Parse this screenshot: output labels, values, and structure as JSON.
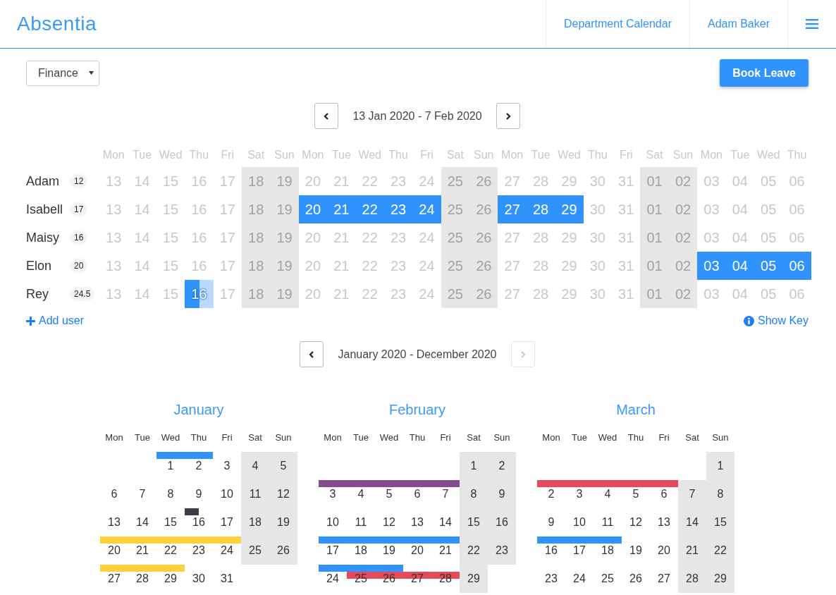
{
  "header": {
    "logo": "Absentia",
    "nav": [
      "Department Calendar",
      "Adam Baker"
    ]
  },
  "toolbar": {
    "department": "Finance",
    "book_button": "Book Leave"
  },
  "week_nav": {
    "range": "13 Jan 2020 - 7 Feb 2020",
    "prev_disabled": false,
    "next_disabled": false
  },
  "team": {
    "columns": [
      {
        "weekday": "Mon",
        "weekend": false
      },
      {
        "weekday": "Tue",
        "weekend": false
      },
      {
        "weekday": "Wed",
        "weekend": false
      },
      {
        "weekday": "Thu",
        "weekend": false
      },
      {
        "weekday": "Fri",
        "weekend": false
      },
      {
        "weekday": "Sat",
        "weekend": true
      },
      {
        "weekday": "Sun",
        "weekend": true
      },
      {
        "weekday": "Mon",
        "weekend": false
      },
      {
        "weekday": "Tue",
        "weekend": false
      },
      {
        "weekday": "Wed",
        "weekend": false
      },
      {
        "weekday": "Thu",
        "weekend": false
      },
      {
        "weekday": "Fri",
        "weekend": false
      },
      {
        "weekday": "Sat",
        "weekend": true
      },
      {
        "weekday": "Sun",
        "weekend": true
      },
      {
        "weekday": "Mon",
        "weekend": false
      },
      {
        "weekday": "Tue",
        "weekend": false
      },
      {
        "weekday": "Wed",
        "weekend": false
      },
      {
        "weekday": "Thu",
        "weekend": false
      },
      {
        "weekday": "Fri",
        "weekend": false
      },
      {
        "weekday": "Sat",
        "weekend": true
      },
      {
        "weekday": "Sun",
        "weekend": true
      },
      {
        "weekday": "Mon",
        "weekend": false
      },
      {
        "weekday": "Tue",
        "weekend": false
      },
      {
        "weekday": "Wed",
        "weekend": false
      },
      {
        "weekday": "Thu",
        "weekend": false
      }
    ],
    "members": [
      {
        "name": "Adam",
        "balance": "12",
        "days": [
          {
            "date": "13",
            "kind": "free"
          },
          {
            "date": "14",
            "kind": "free"
          },
          {
            "date": "15",
            "kind": "free"
          },
          {
            "date": "16",
            "kind": "free"
          },
          {
            "date": "17",
            "kind": "free"
          },
          {
            "date": "18",
            "kind": "free"
          },
          {
            "date": "19",
            "kind": "free"
          },
          {
            "date": "20",
            "kind": "free"
          },
          {
            "date": "21",
            "kind": "free"
          },
          {
            "date": "22",
            "kind": "free"
          },
          {
            "date": "23",
            "kind": "free"
          },
          {
            "date": "24",
            "kind": "free"
          },
          {
            "date": "25",
            "kind": "free"
          },
          {
            "date": "26",
            "kind": "free"
          },
          {
            "date": "27",
            "kind": "free"
          },
          {
            "date": "28",
            "kind": "free"
          },
          {
            "date": "29",
            "kind": "free"
          },
          {
            "date": "30",
            "kind": "free"
          },
          {
            "date": "31",
            "kind": "free"
          },
          {
            "date": "01",
            "kind": "free"
          },
          {
            "date": "02",
            "kind": "free"
          },
          {
            "date": "03",
            "kind": "free"
          },
          {
            "date": "04",
            "kind": "free"
          },
          {
            "date": "05",
            "kind": "free"
          },
          {
            "date": "06",
            "kind": "free"
          }
        ]
      },
      {
        "name": "Isabell",
        "balance": "17",
        "days": [
          {
            "date": "13",
            "kind": "free"
          },
          {
            "date": "14",
            "kind": "free"
          },
          {
            "date": "15",
            "kind": "free"
          },
          {
            "date": "16",
            "kind": "free"
          },
          {
            "date": "17",
            "kind": "free"
          },
          {
            "date": "18",
            "kind": "free"
          },
          {
            "date": "19",
            "kind": "free"
          },
          {
            "date": "20",
            "kind": "leave"
          },
          {
            "date": "21",
            "kind": "leave"
          },
          {
            "date": "22",
            "kind": "leave"
          },
          {
            "date": "23",
            "kind": "leave"
          },
          {
            "date": "24",
            "kind": "leave"
          },
          {
            "date": "25",
            "kind": "free"
          },
          {
            "date": "26",
            "kind": "free"
          },
          {
            "date": "27",
            "kind": "leave"
          },
          {
            "date": "28",
            "kind": "leave"
          },
          {
            "date": "29",
            "kind": "leave"
          },
          {
            "date": "30",
            "kind": "free"
          },
          {
            "date": "31",
            "kind": "free"
          },
          {
            "date": "01",
            "kind": "free"
          },
          {
            "date": "02",
            "kind": "free"
          },
          {
            "date": "03",
            "kind": "free"
          },
          {
            "date": "04",
            "kind": "free"
          },
          {
            "date": "05",
            "kind": "free"
          },
          {
            "date": "06",
            "kind": "free"
          }
        ]
      },
      {
        "name": "Maisy",
        "balance": "16",
        "days": [
          {
            "date": "13",
            "kind": "free"
          },
          {
            "date": "14",
            "kind": "free"
          },
          {
            "date": "15",
            "kind": "free"
          },
          {
            "date": "16",
            "kind": "free"
          },
          {
            "date": "17",
            "kind": "free"
          },
          {
            "date": "18",
            "kind": "free"
          },
          {
            "date": "19",
            "kind": "free"
          },
          {
            "date": "20",
            "kind": "free"
          },
          {
            "date": "21",
            "kind": "free"
          },
          {
            "date": "22",
            "kind": "free"
          },
          {
            "date": "23",
            "kind": "free"
          },
          {
            "date": "24",
            "kind": "free"
          },
          {
            "date": "25",
            "kind": "free"
          },
          {
            "date": "26",
            "kind": "free"
          },
          {
            "date": "27",
            "kind": "free"
          },
          {
            "date": "28",
            "kind": "free"
          },
          {
            "date": "29",
            "kind": "free"
          },
          {
            "date": "30",
            "kind": "free"
          },
          {
            "date": "31",
            "kind": "free"
          },
          {
            "date": "01",
            "kind": "free"
          },
          {
            "date": "02",
            "kind": "free"
          },
          {
            "date": "03",
            "kind": "free"
          },
          {
            "date": "04",
            "kind": "free"
          },
          {
            "date": "05",
            "kind": "free"
          },
          {
            "date": "06",
            "kind": "free"
          }
        ]
      },
      {
        "name": "Elon",
        "balance": "20",
        "days": [
          {
            "date": "13",
            "kind": "free"
          },
          {
            "date": "14",
            "kind": "free"
          },
          {
            "date": "15",
            "kind": "free"
          },
          {
            "date": "16",
            "kind": "free"
          },
          {
            "date": "17",
            "kind": "free"
          },
          {
            "date": "18",
            "kind": "free"
          },
          {
            "date": "19",
            "kind": "free"
          },
          {
            "date": "20",
            "kind": "free"
          },
          {
            "date": "21",
            "kind": "free"
          },
          {
            "date": "22",
            "kind": "free"
          },
          {
            "date": "23",
            "kind": "free"
          },
          {
            "date": "24",
            "kind": "free"
          },
          {
            "date": "25",
            "kind": "free"
          },
          {
            "date": "26",
            "kind": "free"
          },
          {
            "date": "27",
            "kind": "free"
          },
          {
            "date": "28",
            "kind": "free"
          },
          {
            "date": "29",
            "kind": "free"
          },
          {
            "date": "30",
            "kind": "free"
          },
          {
            "date": "31",
            "kind": "free"
          },
          {
            "date": "01",
            "kind": "free"
          },
          {
            "date": "02",
            "kind": "free"
          },
          {
            "date": "03",
            "kind": "leave"
          },
          {
            "date": "04",
            "kind": "leave"
          },
          {
            "date": "05",
            "kind": "leave"
          },
          {
            "date": "06",
            "kind": "leave"
          }
        ]
      },
      {
        "name": "Rey",
        "balance": "24.5",
        "days": [
          {
            "date": "13",
            "kind": "free"
          },
          {
            "date": "14",
            "kind": "free"
          },
          {
            "date": "15",
            "kind": "free"
          },
          {
            "date": "16",
            "kind": "half_leave"
          },
          {
            "date": "17",
            "kind": "free"
          },
          {
            "date": "18",
            "kind": "free"
          },
          {
            "date": "19",
            "kind": "free"
          },
          {
            "date": "20",
            "kind": "free"
          },
          {
            "date": "21",
            "kind": "free"
          },
          {
            "date": "22",
            "kind": "free"
          },
          {
            "date": "23",
            "kind": "free"
          },
          {
            "date": "24",
            "kind": "free"
          },
          {
            "date": "25",
            "kind": "free"
          },
          {
            "date": "26",
            "kind": "free"
          },
          {
            "date": "27",
            "kind": "free"
          },
          {
            "date": "28",
            "kind": "free"
          },
          {
            "date": "29",
            "kind": "free"
          },
          {
            "date": "30",
            "kind": "free"
          },
          {
            "date": "31",
            "kind": "free"
          },
          {
            "date": "01",
            "kind": "free"
          },
          {
            "date": "02",
            "kind": "free"
          },
          {
            "date": "03",
            "kind": "free"
          },
          {
            "date": "04",
            "kind": "free"
          },
          {
            "date": "05",
            "kind": "free"
          },
          {
            "date": "06",
            "kind": "free"
          }
        ]
      }
    ]
  },
  "add_user": "Add user",
  "show_key": "Show Key",
  "year_nav": {
    "range": "January 2020 - December 2020",
    "prev_disabled": false,
    "next_disabled": true
  },
  "months": [
    {
      "name": "January",
      "weekdays": [
        "Mon",
        "Tue",
        "Wed",
        "Thu",
        "Fri",
        "Sat",
        "Sun"
      ],
      "weeks": [
        [
          {
            "kind": "blank"
          },
          {
            "kind": "blank"
          },
          {
            "kind": "day",
            "text": "1",
            "weekend": false,
            "bars": [
              {
                "color": "#3093fd",
                "kind": "full_day",
                "lower": false
              }
            ]
          },
          {
            "kind": "day",
            "text": "2",
            "weekend": false,
            "bars": [
              {
                "color": "#3093fd",
                "kind": "full_day",
                "lower": false
              }
            ]
          },
          {
            "kind": "day",
            "text": "3",
            "weekend": false
          },
          {
            "kind": "day",
            "text": "4",
            "weekend": true
          },
          {
            "kind": "day",
            "text": "5",
            "weekend": true
          }
        ],
        [
          {
            "kind": "day",
            "text": "6",
            "weekend": false
          },
          {
            "kind": "day",
            "text": "7",
            "weekend": false
          },
          {
            "kind": "day",
            "text": "8",
            "weekend": false
          },
          {
            "kind": "day",
            "text": "9",
            "weekend": false
          },
          {
            "kind": "day",
            "text": "10",
            "weekend": false
          },
          {
            "kind": "day",
            "text": "11",
            "weekend": true
          },
          {
            "kind": "day",
            "text": "12",
            "weekend": true
          }
        ],
        [
          {
            "kind": "day",
            "text": "13",
            "weekend": false
          },
          {
            "kind": "day",
            "text": "14",
            "weekend": false
          },
          {
            "kind": "day",
            "text": "15",
            "weekend": false
          },
          {
            "kind": "day",
            "text": "16",
            "weekend": false,
            "bars": [
              {
                "color": "#3d3d4a",
                "kind": "half_day",
                "lower": false
              }
            ]
          },
          {
            "kind": "day",
            "text": "17",
            "weekend": false
          },
          {
            "kind": "day",
            "text": "18",
            "weekend": true
          },
          {
            "kind": "day",
            "text": "19",
            "weekend": true
          }
        ],
        [
          {
            "kind": "day",
            "text": "20",
            "weekend": false,
            "bars": [
              {
                "color": "#ffd03a",
                "kind": "full_day",
                "lower": false
              }
            ]
          },
          {
            "kind": "day",
            "text": "21",
            "weekend": false,
            "bars": [
              {
                "color": "#ffd03a",
                "kind": "full_day",
                "lower": false
              }
            ]
          },
          {
            "kind": "day",
            "text": "22",
            "weekend": false,
            "bars": [
              {
                "color": "#ffd03a",
                "kind": "full_day",
                "lower": false
              }
            ]
          },
          {
            "kind": "day",
            "text": "23",
            "weekend": false,
            "bars": [
              {
                "color": "#ffd03a",
                "kind": "full_day",
                "lower": false
              }
            ]
          },
          {
            "kind": "day",
            "text": "24",
            "weekend": false,
            "bars": [
              {
                "color": "#ffd03a",
                "kind": "full_day",
                "lower": false
              }
            ]
          },
          {
            "kind": "day",
            "text": "25",
            "weekend": true
          },
          {
            "kind": "day",
            "text": "26",
            "weekend": true
          }
        ],
        [
          {
            "kind": "day",
            "text": "27",
            "weekend": false,
            "bars": [
              {
                "color": "#ffd03a",
                "kind": "full_day",
                "lower": false
              }
            ]
          },
          {
            "kind": "day",
            "text": "28",
            "weekend": false,
            "bars": [
              {
                "color": "#ffd03a",
                "kind": "full_day",
                "lower": false
              }
            ]
          },
          {
            "kind": "day",
            "text": "29",
            "weekend": false,
            "bars": [
              {
                "color": "#ffd03a",
                "kind": "full_day",
                "lower": false
              }
            ]
          },
          {
            "kind": "day",
            "text": "30",
            "weekend": false
          },
          {
            "kind": "day",
            "text": "31",
            "weekend": false
          }
        ]
      ]
    },
    {
      "name": "February",
      "weekdays": [
        "Mon",
        "Tue",
        "Wed",
        "Thu",
        "Fri",
        "Sat",
        "Sun"
      ],
      "weeks": [
        [
          {
            "kind": "blank"
          },
          {
            "kind": "blank"
          },
          {
            "kind": "blank"
          },
          {
            "kind": "blank"
          },
          {
            "kind": "blank"
          },
          {
            "kind": "day",
            "text": "1",
            "weekend": true
          },
          {
            "kind": "day",
            "text": "2",
            "weekend": true
          }
        ],
        [
          {
            "kind": "day",
            "text": "3",
            "weekend": false,
            "bars": [
              {
                "color": "#884a8c",
                "kind": "full_day",
                "lower": false
              }
            ]
          },
          {
            "kind": "day",
            "text": "4",
            "weekend": false,
            "bars": [
              {
                "color": "#884a8c",
                "kind": "full_day",
                "lower": false
              }
            ]
          },
          {
            "kind": "day",
            "text": "5",
            "weekend": false,
            "bars": [
              {
                "color": "#884a8c",
                "kind": "full_day",
                "lower": false
              }
            ]
          },
          {
            "kind": "day",
            "text": "6",
            "weekend": false,
            "bars": [
              {
                "color": "#884a8c",
                "kind": "full_day",
                "lower": false
              }
            ]
          },
          {
            "kind": "day",
            "text": "7",
            "weekend": false,
            "bars": [
              {
                "color": "#884a8c",
                "kind": "full_day",
                "lower": false
              }
            ]
          },
          {
            "kind": "day",
            "text": "8",
            "weekend": true
          },
          {
            "kind": "day",
            "text": "9",
            "weekend": true
          }
        ],
        [
          {
            "kind": "day",
            "text": "10",
            "weekend": false
          },
          {
            "kind": "day",
            "text": "11",
            "weekend": false
          },
          {
            "kind": "day",
            "text": "12",
            "weekend": false
          },
          {
            "kind": "day",
            "text": "13",
            "weekend": false
          },
          {
            "kind": "day",
            "text": "14",
            "weekend": false
          },
          {
            "kind": "day",
            "text": "15",
            "weekend": true
          },
          {
            "kind": "day",
            "text": "16",
            "weekend": true
          }
        ],
        [
          {
            "kind": "day",
            "text": "17",
            "weekend": false,
            "bars": [
              {
                "color": "#3093fd",
                "kind": "full_day",
                "lower": false
              }
            ]
          },
          {
            "kind": "day",
            "text": "18",
            "weekend": false,
            "bars": [
              {
                "color": "#3093fd",
                "kind": "full_day",
                "lower": false
              }
            ]
          },
          {
            "kind": "day",
            "text": "19",
            "weekend": false,
            "bars": [
              {
                "color": "#3093fd",
                "kind": "full_day",
                "lower": false
              }
            ]
          },
          {
            "kind": "day",
            "text": "20",
            "weekend": false,
            "bars": [
              {
                "color": "#3093fd",
                "kind": "full_day",
                "lower": false
              }
            ]
          },
          {
            "kind": "day",
            "text": "21",
            "weekend": false,
            "bars": [
              {
                "color": "#3093fd",
                "kind": "full_day",
                "lower": false
              }
            ]
          },
          {
            "kind": "day",
            "text": "22",
            "weekend": true
          },
          {
            "kind": "day",
            "text": "23",
            "weekend": true
          }
        ],
        [
          {
            "kind": "day",
            "text": "24",
            "weekend": false,
            "bars": [
              {
                "color": "#3093fd",
                "kind": "full_day",
                "lower": false
              }
            ]
          },
          {
            "kind": "day",
            "text": "25",
            "weekend": false,
            "bars": [
              {
                "color": "#3093fd",
                "kind": "full_day",
                "lower": false
              },
              {
                "color": "#e64a58",
                "kind": "full_day",
                "lower": true
              }
            ]
          },
          {
            "kind": "day",
            "text": "26",
            "weekend": false,
            "bars": [
              {
                "color": "#3093fd",
                "kind": "full_day",
                "lower": false
              },
              {
                "color": "#e64a58",
                "kind": "full_day",
                "lower": true
              }
            ]
          },
          {
            "kind": "day",
            "text": "27",
            "weekend": false,
            "bars": [
              {
                "color": "#e64a58",
                "kind": "full_day",
                "lower": true
              }
            ]
          },
          {
            "kind": "day",
            "text": "28",
            "weekend": false,
            "bars": [
              {
                "color": "#e64a58",
                "kind": "full_day",
                "lower": true
              }
            ]
          },
          {
            "kind": "day",
            "text": "29",
            "weekend": true
          }
        ]
      ]
    },
    {
      "name": "March",
      "weekdays": [
        "Mon",
        "Tue",
        "Wed",
        "Thu",
        "Fri",
        "Sat",
        "Sun"
      ],
      "weeks": [
        [
          {
            "kind": "blank"
          },
          {
            "kind": "blank"
          },
          {
            "kind": "blank"
          },
          {
            "kind": "blank"
          },
          {
            "kind": "blank"
          },
          {
            "kind": "blank"
          },
          {
            "kind": "day",
            "text": "1",
            "weekend": true
          }
        ],
        [
          {
            "kind": "day",
            "text": "2",
            "weekend": false,
            "bars": [
              {
                "color": "#e64a58",
                "kind": "full_day",
                "lower": false
              }
            ]
          },
          {
            "kind": "day",
            "text": "3",
            "weekend": false,
            "bars": [
              {
                "color": "#e64a58",
                "kind": "full_day",
                "lower": false
              }
            ]
          },
          {
            "kind": "day",
            "text": "4",
            "weekend": false,
            "bars": [
              {
                "color": "#e64a58",
                "kind": "full_day",
                "lower": false
              }
            ]
          },
          {
            "kind": "day",
            "text": "5",
            "weekend": false,
            "bars": [
              {
                "color": "#e64a58",
                "kind": "full_day",
                "lower": false
              }
            ]
          },
          {
            "kind": "day",
            "text": "6",
            "weekend": false,
            "bars": [
              {
                "color": "#e64a58",
                "kind": "full_day",
                "lower": false
              }
            ]
          },
          {
            "kind": "day",
            "text": "7",
            "weekend": true
          },
          {
            "kind": "day",
            "text": "8",
            "weekend": true
          }
        ],
        [
          {
            "kind": "day",
            "text": "9",
            "weekend": false
          },
          {
            "kind": "day",
            "text": "10",
            "weekend": false
          },
          {
            "kind": "day",
            "text": "11",
            "weekend": false
          },
          {
            "kind": "day",
            "text": "12",
            "weekend": false
          },
          {
            "kind": "day",
            "text": "13",
            "weekend": false
          },
          {
            "kind": "day",
            "text": "14",
            "weekend": true
          },
          {
            "kind": "day",
            "text": "15",
            "weekend": true
          }
        ],
        [
          {
            "kind": "day",
            "text": "16",
            "weekend": false,
            "bars": [
              {
                "color": "#3093fd",
                "kind": "full_day",
                "lower": false
              }
            ]
          },
          {
            "kind": "day",
            "text": "17",
            "weekend": false,
            "bars": [
              {
                "color": "#3093fd",
                "kind": "full_day",
                "lower": false
              }
            ]
          },
          {
            "kind": "day",
            "text": "18",
            "weekend": false,
            "bars": [
              {
                "color": "#3093fd",
                "kind": "full_day",
                "lower": false
              }
            ]
          },
          {
            "kind": "day",
            "text": "19",
            "weekend": false
          },
          {
            "kind": "day",
            "text": "20",
            "weekend": false
          },
          {
            "kind": "day",
            "text": "21",
            "weekend": true
          },
          {
            "kind": "day",
            "text": "22",
            "weekend": true
          }
        ],
        [
          {
            "kind": "day",
            "text": "23",
            "weekend": false
          },
          {
            "kind": "day",
            "text": "24",
            "weekend": false
          },
          {
            "kind": "day",
            "text": "25",
            "weekend": false
          },
          {
            "kind": "day",
            "text": "26",
            "weekend": false
          },
          {
            "kind": "day",
            "text": "27",
            "weekend": false
          },
          {
            "kind": "day",
            "text": "28",
            "weekend": true
          },
          {
            "kind": "day",
            "text": "29",
            "weekend": true
          }
        ]
      ]
    }
  ]
}
